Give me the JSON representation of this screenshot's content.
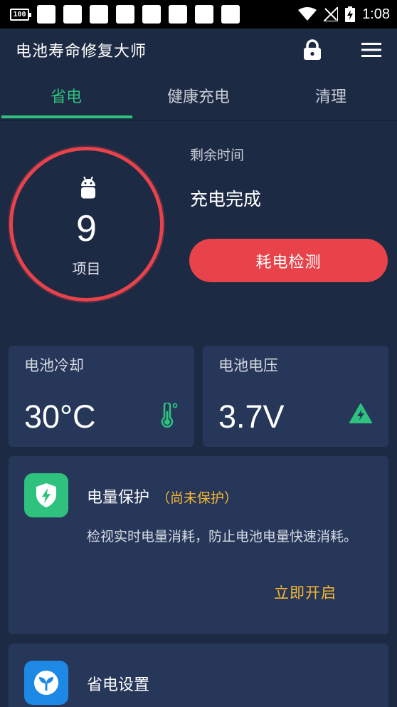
{
  "status_bar": {
    "battery_text": "100",
    "time": "1:08"
  },
  "app": {
    "title": "电池寿命修复大师"
  },
  "tabs": [
    {
      "label": "省电",
      "active": true
    },
    {
      "label": "健康充电",
      "active": false
    },
    {
      "label": "清理",
      "active": false
    }
  ],
  "summary": {
    "count": "9",
    "count_label": "项目",
    "remaining_label": "剩余时间",
    "remaining_value": "充电完成",
    "detect_button": "耗电检测"
  },
  "metrics": {
    "cooling": {
      "title": "电池冷却",
      "value": "30°C",
      "icon": "thermometer-icon"
    },
    "voltage": {
      "title": "电池电压",
      "value": "3.7V",
      "icon": "battery-warning-icon"
    }
  },
  "features": {
    "protection": {
      "title": "电量保护",
      "status": "（尚未保护）",
      "description": "检视实时电量消耗，防止电池电量快速消耗。",
      "action": "立即开启",
      "icon": "shield-bolt-icon"
    },
    "settings": {
      "title": "省电设置",
      "icon": "sprout-icon"
    }
  },
  "colors": {
    "background": "#1d2a44",
    "card": "#27375a",
    "accent_green": "#2ec27e",
    "accent_red": "#e8434a",
    "accent_yellow": "#f5b731",
    "icon_blue": "#1e88e5"
  }
}
